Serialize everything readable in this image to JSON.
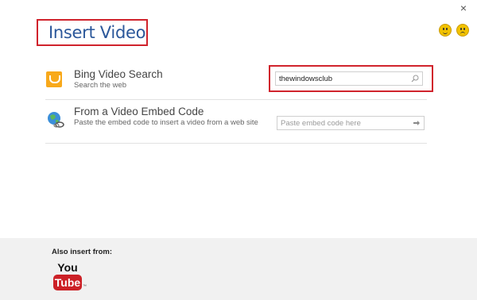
{
  "dialog": {
    "title": "Insert Video",
    "close_glyph": "×",
    "feedback": [
      {
        "icon": "smile-icon",
        "color": "#f2c200"
      },
      {
        "icon": "frown-icon",
        "color": "#f2c200"
      }
    ]
  },
  "bing": {
    "icon": "bing-icon",
    "title": "Bing Video Search",
    "subtitle": "Search the web",
    "search_value": "thewindowsclub",
    "search_icon": "magnifier-icon"
  },
  "embed": {
    "icon": "globe-icon",
    "title": "From a Video Embed Code",
    "subtitle": "Paste the embed code to insert a video from a web site",
    "placeholder": "Paste embed code here",
    "submit_icon": "arrow-right-icon"
  },
  "footer": {
    "label": "Also insert from:",
    "youtube": {
      "you": "You",
      "tube": "Tube",
      "mark": "™"
    }
  },
  "colors": {
    "title": "#2b579a",
    "highlight": "#d0232c",
    "bing": "#f8a91b",
    "youtube": "#cc2127",
    "footer_bg": "#f1f1f1"
  }
}
